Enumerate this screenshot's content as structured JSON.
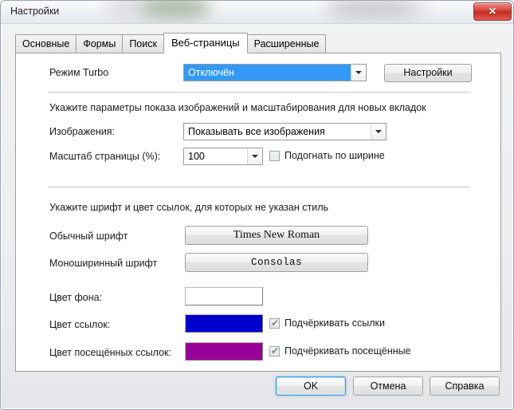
{
  "window": {
    "title": "Настройки",
    "close_glyph": "✕"
  },
  "tabs": [
    {
      "label": "Основные",
      "active": false
    },
    {
      "label": "Формы",
      "active": false
    },
    {
      "label": "Поиск",
      "active": false
    },
    {
      "label": "Веб-страницы",
      "active": true
    },
    {
      "label": "Расширенные",
      "active": false
    }
  ],
  "turbo": {
    "label": "Режим Turbo",
    "value": "Отключён",
    "settings_button": "Настройки"
  },
  "images": {
    "section_text": "Укажите параметры показа изображений и масштабирования для новых вкладок",
    "label": "Изображения:",
    "value": "Показывать все изображения"
  },
  "scale": {
    "label": "Масштаб страницы (%):",
    "value": "100",
    "fit_width_label": "Подогнать по ширине",
    "fit_width_checked": false
  },
  "fonts": {
    "section_text": "Укажите шрифт и цвет ссылок, для которых не указан стиль",
    "normal_label": "Обычный шрифт",
    "normal_value": "Times New Roman",
    "mono_label": "Моноширинный шрифт",
    "mono_value": "Consolas"
  },
  "colors": {
    "background_label": "Цвет фона:",
    "background_color": "#ffffff",
    "link_label": "Цвет ссылок:",
    "link_color": "#0000cc",
    "visited_label": "Цвет посещённых ссылок:",
    "visited_color": "#990099",
    "underline_links_label": "Подчёркивать ссылки",
    "underline_links_checked": true,
    "underline_visited_label": "Подчёркивать посещённые",
    "underline_visited_checked": true,
    "check_glyph": "✔"
  },
  "footer": {
    "ok": "OK",
    "cancel": "Отмена",
    "help": "Справка"
  }
}
